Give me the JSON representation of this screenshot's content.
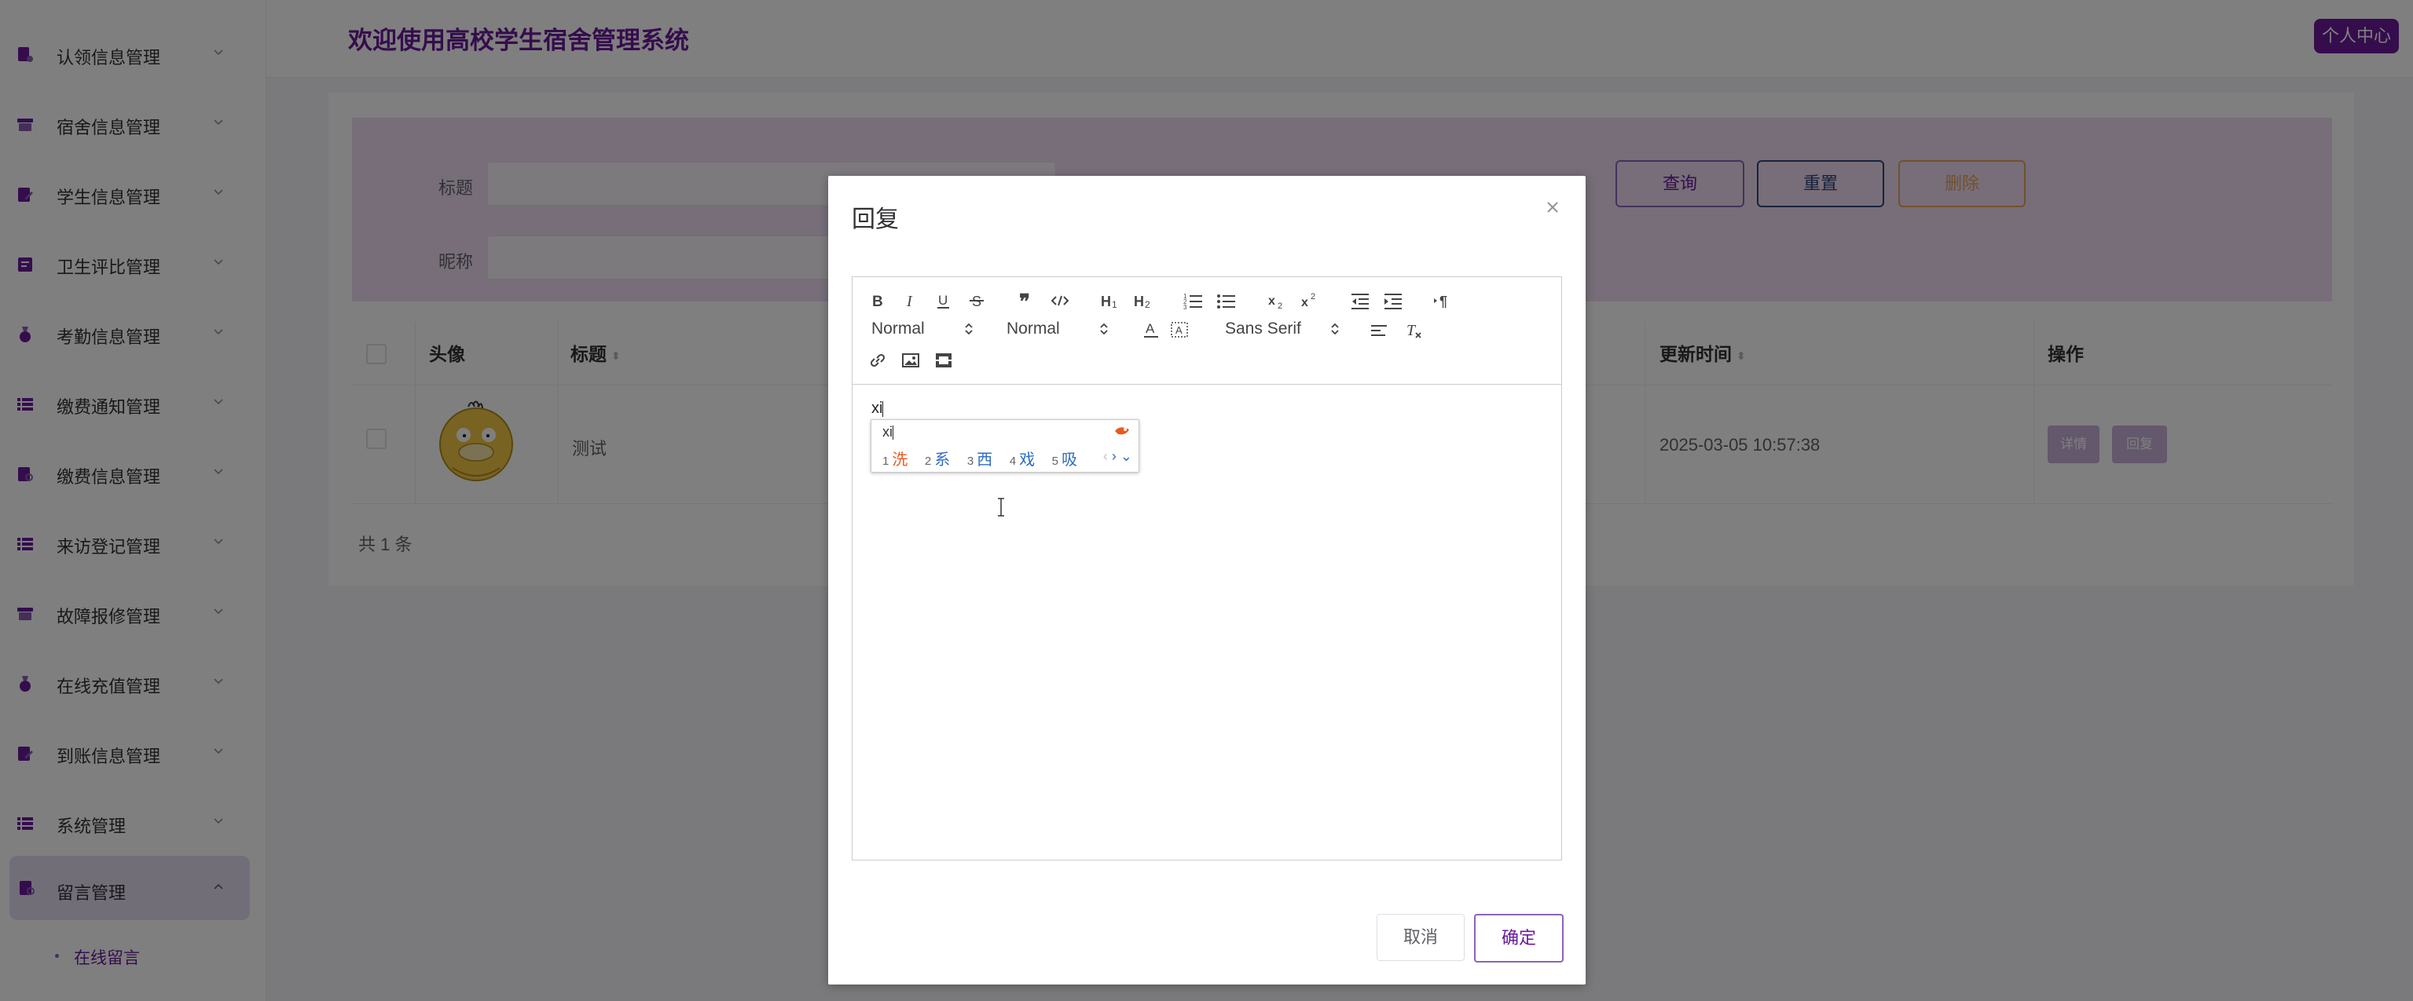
{
  "app": {
    "title": "欢迎使用高校学生宿舍管理系统",
    "user_center": "个人中心"
  },
  "sidebar": {
    "items": [
      {
        "label": "认领信息管理",
        "icon": "document-icon"
      },
      {
        "label": "宿舍信息管理",
        "icon": "archive-icon"
      },
      {
        "label": "学生信息管理",
        "icon": "edit-document-icon"
      },
      {
        "label": "卫生评比管理",
        "icon": "report-icon"
      },
      {
        "label": "考勤信息管理",
        "icon": "medal-icon"
      },
      {
        "label": "缴费通知管理",
        "icon": "list-icon"
      },
      {
        "label": "缴费信息管理",
        "icon": "search-document-icon"
      },
      {
        "label": "来访登记管理",
        "icon": "list-icon"
      },
      {
        "label": "故障报修管理",
        "icon": "archive-icon"
      },
      {
        "label": "在线充值管理",
        "icon": "medal-icon"
      },
      {
        "label": "到账信息管理",
        "icon": "edit-document-icon"
      },
      {
        "label": "系统管理",
        "icon": "list-icon"
      },
      {
        "label": "留言管理",
        "icon": "search-document-icon",
        "expanded": true
      }
    ],
    "submenu": {
      "label": "在线留言",
      "selected": true
    }
  },
  "filter": {
    "title_label": "标题",
    "title_value": "",
    "nickname_label": "昵称",
    "nickname_value": "",
    "query_label": "查询",
    "reset_label": "重置",
    "delete_label": "删除"
  },
  "table": {
    "columns": {
      "avatar": "头像",
      "title": "标题",
      "updated": "更新时间",
      "actions": "操作"
    },
    "rows": [
      {
        "avatar": "duck-avatar",
        "title": "测试",
        "updated": "2025-03-05 10:57:38",
        "detail_label": "详情",
        "reply_label": "回复"
      }
    ],
    "total": "共 1 条"
  },
  "modal": {
    "title": "回复",
    "editor": {
      "header_select": "Normal",
      "size_select": "Normal",
      "font_select": "Sans Serif",
      "content": "xi"
    },
    "ime": {
      "input": "xi",
      "candidates": [
        {
          "num": "1",
          "text": "洗"
        },
        {
          "num": "2",
          "text": "系"
        },
        {
          "num": "3",
          "text": "西"
        },
        {
          "num": "4",
          "text": "戏"
        },
        {
          "num": "5",
          "text": "吸"
        }
      ]
    },
    "cancel_label": "取消",
    "ok_label": "确定"
  },
  "colors": {
    "brand": "#6a1b9a",
    "filter_bg": "#eedcf3",
    "reset_border": "#31457a",
    "delete_border": "#e6a15a",
    "overlay": "rgba(0,0,0,0.5)"
  }
}
